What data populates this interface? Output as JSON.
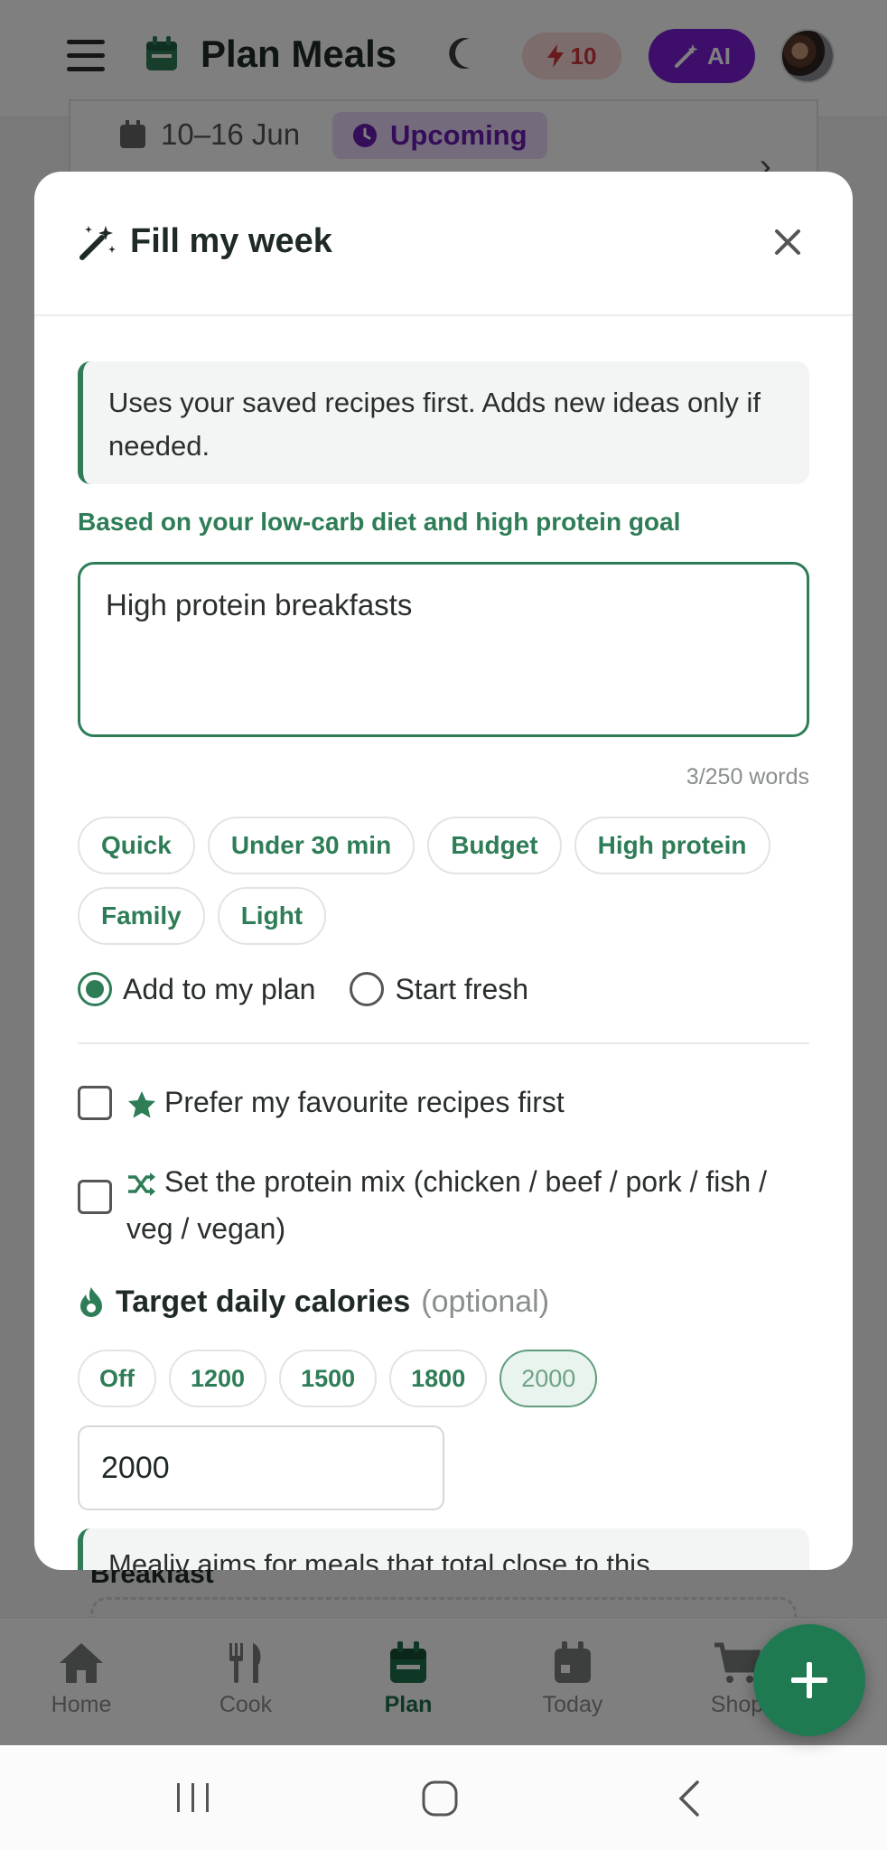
{
  "app": {
    "title": "Plan Meals",
    "credits": "10",
    "ai_label": "AI"
  },
  "week": {
    "date_range": "10–16 Jun",
    "status": "Upcoming"
  },
  "background": {
    "section_peek": "Breakfast"
  },
  "nav": {
    "items": [
      {
        "label": "Home",
        "icon": "home-icon"
      },
      {
        "label": "Cook",
        "icon": "cutlery-icon"
      },
      {
        "label": "Plan",
        "icon": "calendar-icon"
      },
      {
        "label": "Today",
        "icon": "calendar-icon"
      },
      {
        "label": "Shop",
        "icon": "cart-icon"
      }
    ],
    "active": "Plan"
  },
  "modal": {
    "title": "Fill my week",
    "info": "Uses your saved recipes first. Adds new ideas only if needed.",
    "hint": "Based on your low-carb diet and high protein goal",
    "prompt_value": "High protein breakfasts",
    "word_count": "3/250 words",
    "chips": [
      "Quick",
      "Under 30 min",
      "Budget",
      "High protein",
      "Family",
      "Light"
    ],
    "mode_options": [
      {
        "label": "Add to my plan",
        "selected": true
      },
      {
        "label": "Start fresh",
        "selected": false
      }
    ],
    "favourites_label": "Prefer my favourite recipes first",
    "protein_mix_label": "Set the protein mix (chicken / beef / pork / fish / veg / vegan)",
    "calories": {
      "label": "Target daily calories",
      "optional": "(optional)",
      "options": [
        "Off",
        "1200",
        "1500",
        "1800",
        "2000"
      ],
      "selected": "2000",
      "value": "2000",
      "note": "Mealiy aims for meals that total close to this"
    }
  },
  "colors": {
    "brand_green": "#2e7d57",
    "ai_purple": "#7a1fd6",
    "credits_red": "#d0343a"
  }
}
